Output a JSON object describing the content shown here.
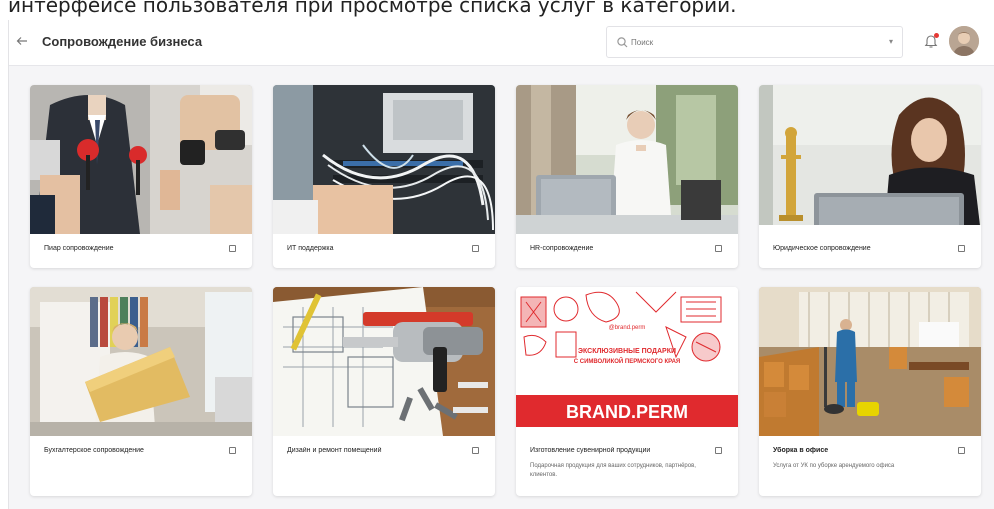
{
  "caption": "интерфейсе пользователя при просмотре списка услуг в категории.",
  "header": {
    "title": "Сопровождение бизнеса",
    "back_icon": "arrow-left-icon",
    "search_placeholder": "Поиск",
    "has_notification": true
  },
  "cards": [
    {
      "title": "Пиар сопровождение",
      "description": "",
      "image": "press-microphones"
    },
    {
      "title": "ИТ поддержка",
      "description": "",
      "image": "server-cables"
    },
    {
      "title": "HR-сопровождение",
      "description": "",
      "image": "woman-laptop-office"
    },
    {
      "title": "Юридическое сопровождение",
      "description": "",
      "image": "lawyer-laptop"
    },
    {
      "title": "Бухгалтерское сопровождение",
      "description": "",
      "image": "woman-folder"
    },
    {
      "title": "Дизайн и ремонт помещений",
      "description": "",
      "image": "blueprint-drill"
    },
    {
      "title": "Изготовление сувенирной продукции",
      "description": "Подарочная продукция для ваших сотрудников, партнёров, клиентов.",
      "image": "brand-perm"
    },
    {
      "title": "Уборка в офисе",
      "description": "Услуга от УК по уборке арендуемого офиса",
      "image": "office-cleaning"
    }
  ],
  "brand_banner": {
    "line1": "ЭКСКЛЮЗИВНЫЕ ПОДАРКИ",
    "line2": "С СИМВОЛИКОЙ ПЕРМСКОГО КРАЯ",
    "handle": "@brand.perm",
    "name": "BRAND.PERM"
  },
  "colors": {
    "accent_red": "#e53935",
    "brand_red": "#e02a2e",
    "background": "#f5f5f7"
  }
}
